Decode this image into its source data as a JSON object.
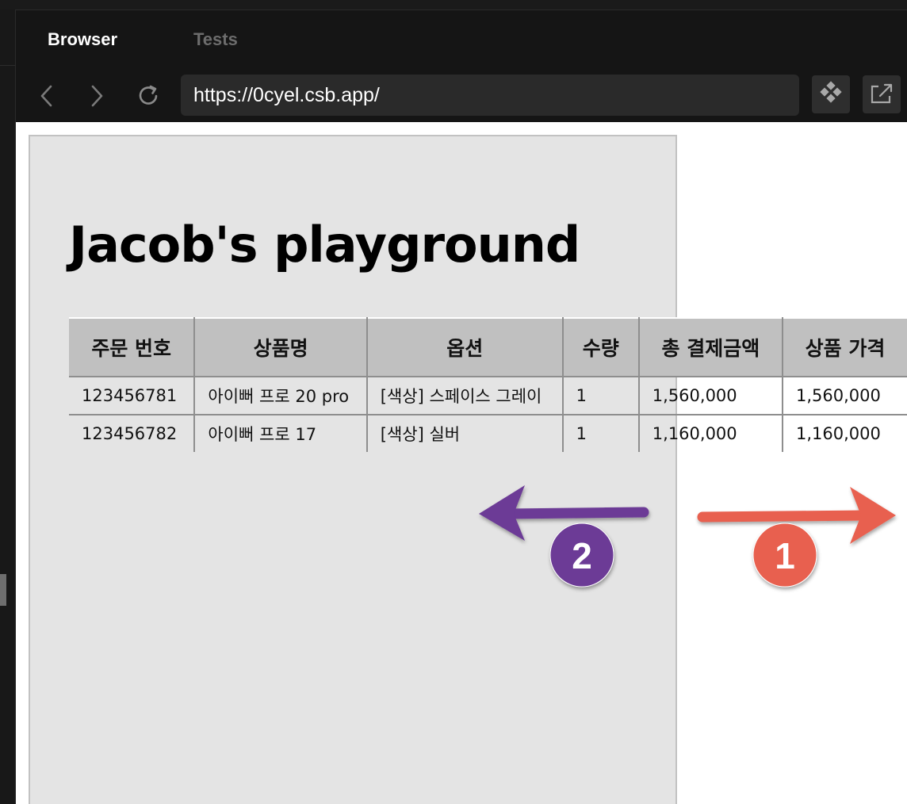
{
  "tabs": [
    {
      "label": "Browser",
      "active": true
    },
    {
      "label": "Tests",
      "active": false
    }
  ],
  "toolbar": {
    "back_icon": "chevron-left-icon",
    "forward_icon": "chevron-right-icon",
    "reload_icon": "reload-icon",
    "url": "https://0cyel.csb.app/",
    "inspector_icon": "diamond-grid-icon",
    "open_external_icon": "open-external-icon"
  },
  "page": {
    "title": "Jacob's playground",
    "table": {
      "headers": [
        "주문 번호",
        "상품명",
        "옵션",
        "수량",
        "총 결제금액",
        "상품 가격"
      ],
      "rows": [
        [
          "123456781",
          "아이뻐 프로 20 pro",
          "[색상] 스페이스 그레이",
          "1",
          "1,560,000",
          "1,560,000"
        ],
        [
          "123456782",
          "아이뻐 프로 17",
          "[색상] 실버",
          "1",
          "1,160,000",
          "1,160,000"
        ]
      ]
    }
  },
  "annotations": [
    {
      "number": "1",
      "direction": "right",
      "color": "#e8604f"
    },
    {
      "number": "2",
      "direction": "left",
      "color": "#6c3a96"
    }
  ]
}
